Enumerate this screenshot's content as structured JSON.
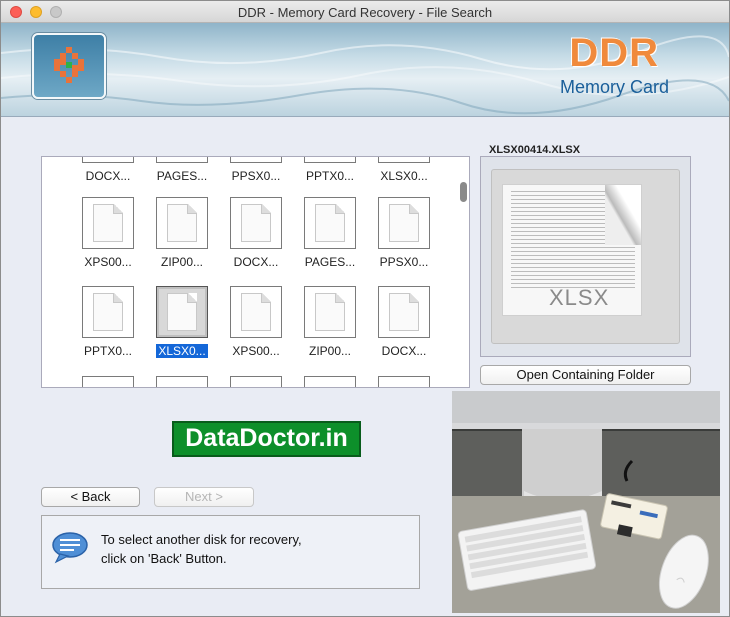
{
  "window": {
    "title": "DDR - Memory Card Recovery - File Search"
  },
  "header": {
    "brand": "DDR",
    "brand_sub": "Memory Card",
    "logo_icon": "ddr-logo-icon"
  },
  "files": [
    {
      "name": "DOCX..."
    },
    {
      "name": "PAGES..."
    },
    {
      "name": "PPSX0..."
    },
    {
      "name": "PPTX0..."
    },
    {
      "name": "XLSX0..."
    },
    {
      "name": "XPS00..."
    },
    {
      "name": "ZIP00..."
    },
    {
      "name": "DOCX..."
    },
    {
      "name": "PAGES..."
    },
    {
      "name": "PPSX0..."
    },
    {
      "name": "PPTX0..."
    },
    {
      "name": "XLSX0...",
      "selected": true
    },
    {
      "name": "XPS00..."
    },
    {
      "name": "ZIP00..."
    },
    {
      "name": "DOCX..."
    }
  ],
  "preview": {
    "filename": "XLSX00414.XLSX",
    "file_type_label": "XLSX",
    "open_folder_label": "Open Containing Folder"
  },
  "branding": {
    "datadoctor": "DataDoctor.in"
  },
  "nav": {
    "back_label": "< Back",
    "next_label": "Next >"
  },
  "info": {
    "line1": "To select another disk for recovery,",
    "line2": "click on 'Back' Button.",
    "icon": "speech-bubble-icon"
  },
  "colors": {
    "brand_orange": "#f08a3c",
    "brand_blue": "#1a5f9a",
    "selection_blue": "#1467d8",
    "datadoctor_green": "#0d8f2a"
  }
}
